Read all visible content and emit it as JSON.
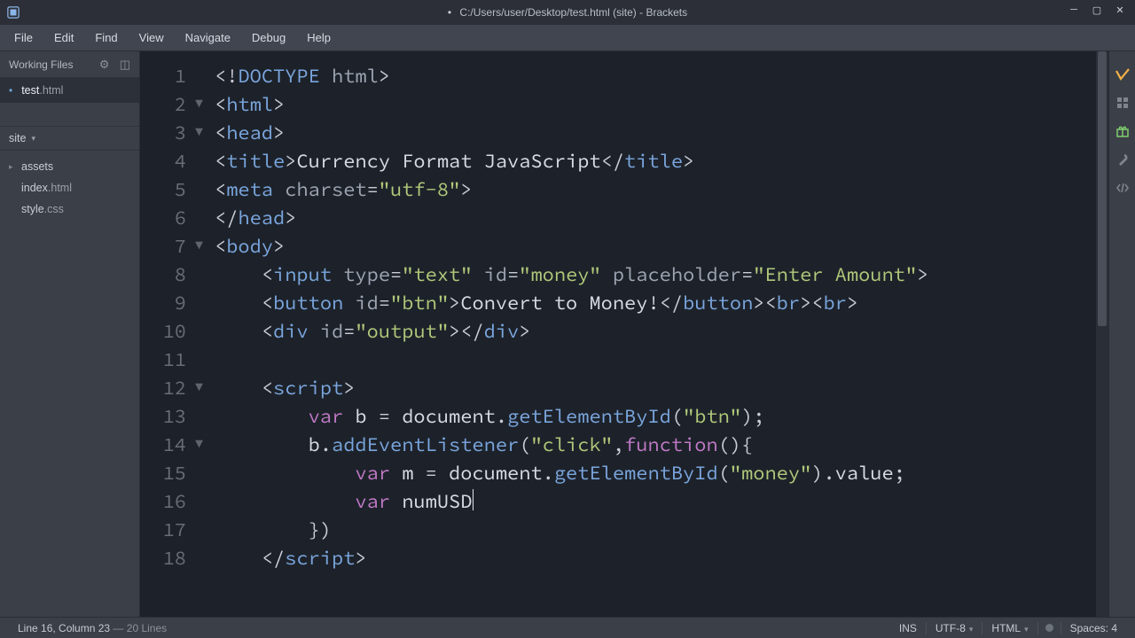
{
  "window": {
    "dirty_marker": "•",
    "title": "C:/Users/user/Desktop/test.html (site) - Brackets"
  },
  "menu": [
    "File",
    "Edit",
    "Find",
    "View",
    "Navigate",
    "Debug",
    "Help"
  ],
  "sidebar": {
    "working_files_label": "Working Files",
    "working_files": [
      {
        "bullet": "•",
        "name": "test",
        "ext": ".html"
      }
    ],
    "project_name": "site",
    "tree": [
      {
        "kind": "folder",
        "twisty": "▸",
        "name": "assets",
        "ext": ""
      },
      {
        "kind": "file",
        "twisty": "",
        "name": "index",
        "ext": ".html"
      },
      {
        "kind": "file",
        "twisty": "",
        "name": "style",
        "ext": ".css"
      }
    ]
  },
  "editor": {
    "line_count": 18,
    "fold_markers": {
      "2": "▼",
      "3": "▼",
      "7": "▼",
      "12": "▼",
      "14": "▼"
    },
    "tokens": {
      "l1": [
        [
          "tag-angle",
          "<!"
        ],
        [
          "tag-name",
          "DOCTYPE"
        ],
        [
          "tag-angle",
          " "
        ],
        [
          "attr-name",
          "html"
        ],
        [
          "tag-angle",
          ">"
        ]
      ],
      "l2": [
        [
          "tag-angle",
          "<"
        ],
        [
          "tag-name",
          "html"
        ],
        [
          "tag-angle",
          ">"
        ]
      ],
      "l3": [
        [
          "tag-angle",
          "<"
        ],
        [
          "tag-name",
          "head"
        ],
        [
          "tag-angle",
          ">"
        ]
      ],
      "l4": [
        [
          "tag-angle",
          "<"
        ],
        [
          "tag-name",
          "title"
        ],
        [
          "tag-angle",
          ">"
        ],
        [
          "ident",
          "Currency Format JavaScript"
        ],
        [
          "tag-angle",
          "</"
        ],
        [
          "tag-name",
          "title"
        ],
        [
          "tag-angle",
          ">"
        ]
      ],
      "l5": [
        [
          "tag-angle",
          "<"
        ],
        [
          "tag-name",
          "meta"
        ],
        [
          "tag-angle",
          " "
        ],
        [
          "attr-name",
          "charset"
        ],
        [
          "punct",
          "="
        ],
        [
          "attr-val",
          "\"utf-8\""
        ],
        [
          "tag-angle",
          ">"
        ]
      ],
      "l6": [
        [
          "tag-angle",
          "</"
        ],
        [
          "tag-name",
          "head"
        ],
        [
          "tag-angle",
          ">"
        ]
      ],
      "l7": [
        [
          "tag-angle",
          "<"
        ],
        [
          "tag-name",
          "body"
        ],
        [
          "tag-angle",
          ">"
        ]
      ],
      "l8": [
        [
          "tag-angle",
          "<"
        ],
        [
          "tag-name",
          "input"
        ],
        [
          "tag-angle",
          " "
        ],
        [
          "attr-name",
          "type"
        ],
        [
          "punct",
          "="
        ],
        [
          "attr-val",
          "\"text\""
        ],
        [
          "tag-angle",
          " "
        ],
        [
          "attr-name",
          "id"
        ],
        [
          "punct",
          "="
        ],
        [
          "attr-val",
          "\"money\""
        ],
        [
          "tag-angle",
          " "
        ],
        [
          "attr-name",
          "placeholder"
        ],
        [
          "punct",
          "="
        ],
        [
          "attr-val",
          "\"Enter Amount\""
        ],
        [
          "tag-angle",
          ">"
        ]
      ],
      "l9": [
        [
          "tag-angle",
          "<"
        ],
        [
          "tag-name",
          "button"
        ],
        [
          "tag-angle",
          " "
        ],
        [
          "attr-name",
          "id"
        ],
        [
          "punct",
          "="
        ],
        [
          "attr-val",
          "\"btn\""
        ],
        [
          "tag-angle",
          ">"
        ],
        [
          "ident",
          "Convert to Money!"
        ],
        [
          "tag-angle",
          "</"
        ],
        [
          "tag-name",
          "button"
        ],
        [
          "tag-angle",
          ">"
        ],
        [
          "tag-angle",
          "<"
        ],
        [
          "tag-name",
          "br"
        ],
        [
          "tag-angle",
          ">"
        ],
        [
          "tag-angle",
          "<"
        ],
        [
          "tag-name",
          "br"
        ],
        [
          "tag-angle",
          ">"
        ]
      ],
      "l10": [
        [
          "tag-angle",
          "<"
        ],
        [
          "tag-name",
          "div"
        ],
        [
          "tag-angle",
          " "
        ],
        [
          "attr-name",
          "id"
        ],
        [
          "punct",
          "="
        ],
        [
          "attr-val",
          "\"output\""
        ],
        [
          "tag-angle",
          ">"
        ],
        [
          "tag-angle",
          "</"
        ],
        [
          "tag-name",
          "div"
        ],
        [
          "tag-angle",
          ">"
        ]
      ],
      "l11": [],
      "l12": [
        [
          "tag-angle",
          "<"
        ],
        [
          "tag-name",
          "script"
        ],
        [
          "tag-angle",
          ">"
        ]
      ],
      "l13": [
        [
          "kw",
          "var"
        ],
        [
          "ident",
          " b "
        ],
        [
          "punct",
          "= "
        ],
        [
          "ident",
          "document"
        ],
        [
          "punct",
          "."
        ],
        [
          "func",
          "getElementById"
        ],
        [
          "punct",
          "("
        ],
        [
          "str",
          "\"btn\""
        ],
        [
          "punct",
          ");"
        ]
      ],
      "l14": [
        [
          "ident",
          "b"
        ],
        [
          "punct",
          "."
        ],
        [
          "func",
          "addEventListener"
        ],
        [
          "punct",
          "("
        ],
        [
          "str",
          "\"click\""
        ],
        [
          "punct",
          ","
        ],
        [
          "kw",
          "function"
        ],
        [
          "punct",
          "(){"
        ]
      ],
      "l15": [
        [
          "kw",
          "var"
        ],
        [
          "ident",
          " m "
        ],
        [
          "punct",
          "= "
        ],
        [
          "ident",
          "document"
        ],
        [
          "punct",
          "."
        ],
        [
          "func",
          "getElementById"
        ],
        [
          "punct",
          "("
        ],
        [
          "str",
          "\"money\""
        ],
        [
          "punct",
          ")."
        ],
        [
          "ident",
          "value"
        ],
        [
          "punct",
          ";"
        ]
      ],
      "l16": [
        [
          "kw",
          "var"
        ],
        [
          "ident",
          " numUSD"
        ]
      ],
      "l17": [
        [
          "punct",
          "})"
        ]
      ],
      "l18": [
        [
          "tag-angle",
          "</"
        ],
        [
          "tag-name",
          "script"
        ],
        [
          "tag-angle",
          ">"
        ]
      ]
    },
    "indent": {
      "l8": 4,
      "l9": 4,
      "l10": 4,
      "l12": 4,
      "l13": 8,
      "l14": 8,
      "l15": 12,
      "l16": 12,
      "l17": 8,
      "l18": 4
    },
    "cursor_line": 16
  },
  "status": {
    "position": "Line 16, Column 23",
    "total_lines": "20 Lines",
    "ins": "INS",
    "encoding": "UTF-8",
    "lang": "HTML",
    "spaces": "Spaces: 4"
  },
  "right_toolbar": [
    "live-preview-icon",
    "extensions-icon",
    "gift-icon",
    "wrench-icon",
    "code-inspect-icon"
  ]
}
